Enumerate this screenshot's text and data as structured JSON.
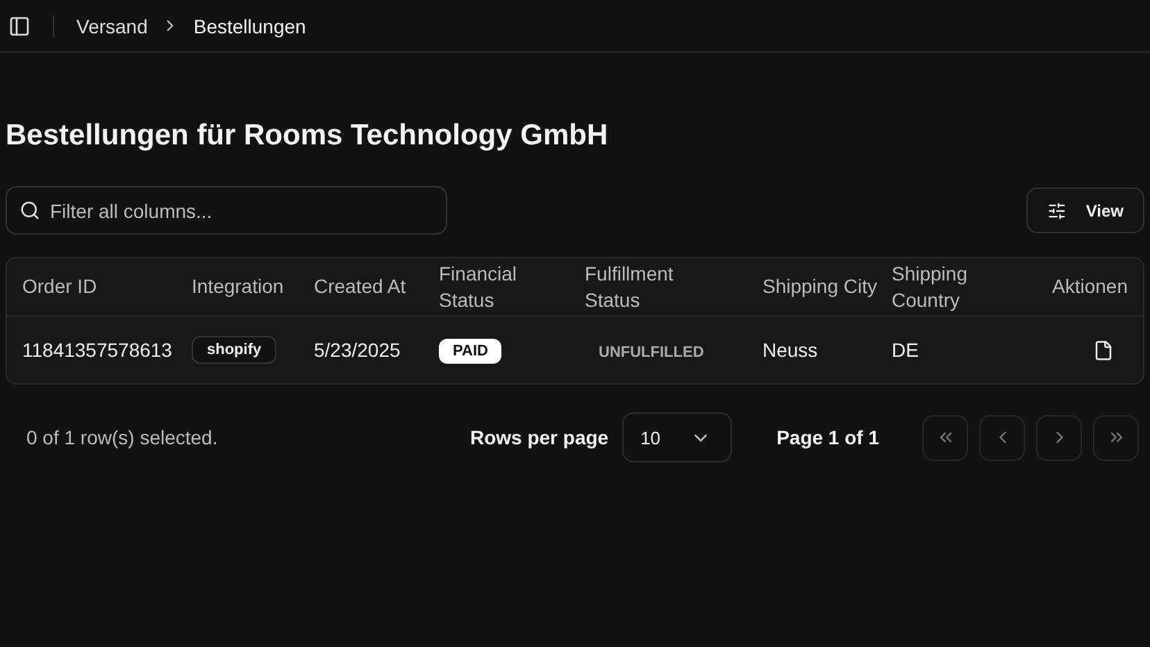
{
  "breadcrumb": [
    "Versand",
    "Bestellungen"
  ],
  "title": "Bestellungen für Rooms Technology GmbH",
  "search": {
    "placeholder": "Filter all columns..."
  },
  "view_button": "View",
  "table": {
    "columns": [
      "Order ID",
      "Integration",
      "Created At",
      "Financial Status",
      "Fulfillment Status",
      "Shipping City",
      "Shipping Country",
      "Aktionen"
    ],
    "rows": [
      {
        "order_id": "11841357578613",
        "integration": "shopify",
        "created_at": "5/23/2025",
        "financial_status": "PAID",
        "fulfillment_status": "UNFULFILLED",
        "city": "Neuss",
        "country": "DE"
      }
    ]
  },
  "footer": {
    "selection": "0 of 1 row(s) selected.",
    "rows_per_page_label": "Rows per page",
    "rows_per_page": "10",
    "page": "Page 1 of 1",
    "pager": [
      {
        "kind": "first",
        "disabled": true
      },
      {
        "kind": "prev",
        "disabled": true
      },
      {
        "kind": "next",
        "disabled": true
      },
      {
        "kind": "last",
        "disabled": true
      }
    ]
  }
}
